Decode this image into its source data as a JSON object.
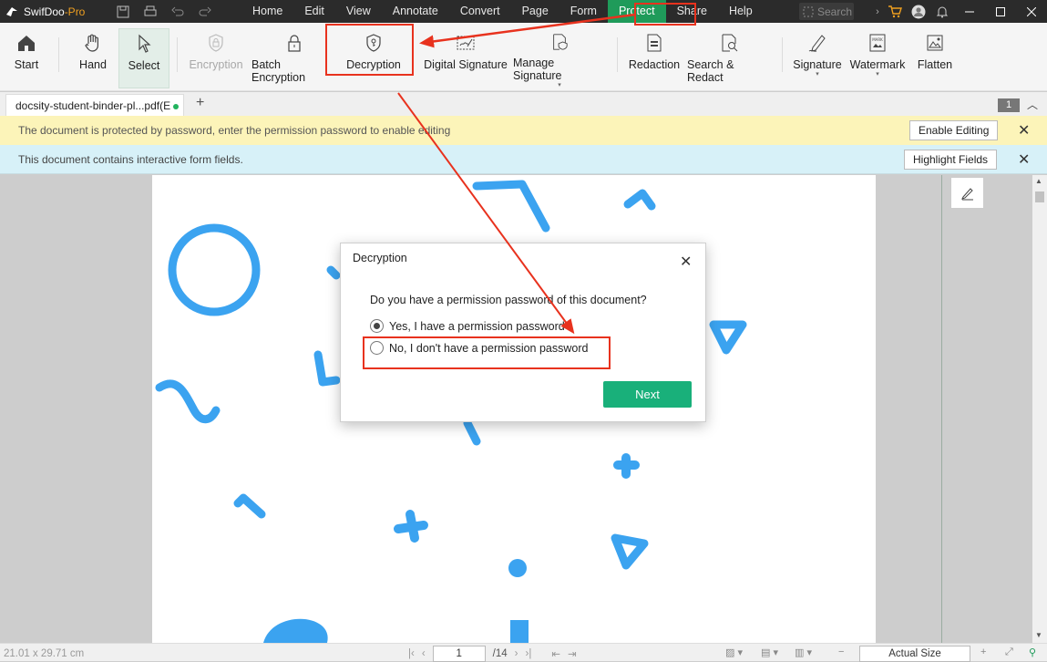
{
  "app": {
    "name": "SwifDoo",
    "edition": "-Pro"
  },
  "menu": [
    "Home",
    "Edit",
    "View",
    "Annotate",
    "Convert",
    "Page",
    "Form",
    "Protect",
    "Share",
    "Help"
  ],
  "active_menu": "Protect",
  "search_placeholder": "Search",
  "ribbon": {
    "start": "Start",
    "hand": "Hand",
    "select": "Select",
    "encryption": "Encryption",
    "batch_encryption": "Batch Encryption",
    "decryption": "Decryption",
    "digital_signature": "Digital Signature",
    "manage_signature": "Manage Signature",
    "redaction": "Redaction",
    "search_redact": "Search & Redact",
    "signature": "Signature",
    "watermark": "Watermark",
    "flatten": "Flatten"
  },
  "tab": {
    "title": "docsity-student-binder-pl...pdf(E",
    "page_count_badge": "1"
  },
  "notifications": {
    "password": "The document is protected by password, enter the permission password to enable editing",
    "enable_editing": "Enable Editing",
    "form_fields": "This document contains interactive form fields.",
    "highlight_fields": "Highlight Fields"
  },
  "dialog": {
    "title": "Decryption",
    "question": "Do you have a permission password of this document?",
    "option_yes": "Yes, I have a permission password",
    "option_no": "No, I don't have a permission password",
    "selected": "yes",
    "next": "Next"
  },
  "status": {
    "dimensions": "21.01 x 29.71 cm",
    "current_page": "1",
    "total_pages": "/14",
    "zoom": "Actual Size"
  },
  "colors": {
    "accent": "#1f9b5a",
    "next_button": "#19b07a",
    "annotation": "#e8321e",
    "shapes": "#3ba3f0"
  }
}
